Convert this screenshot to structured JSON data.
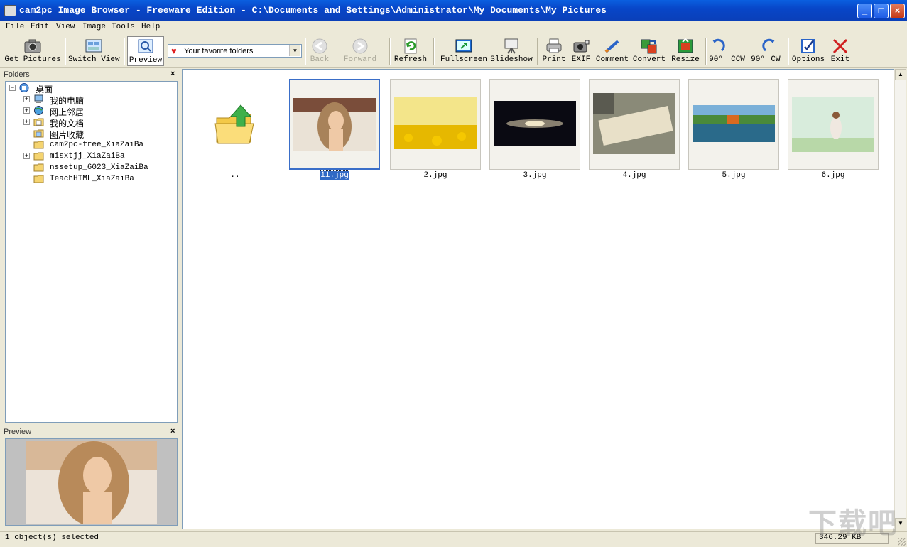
{
  "window": {
    "title": "cam2pc Image Browser - Freeware Edition - C:\\Documents and Settings\\Administrator\\My Documents\\My Pictures"
  },
  "menu": [
    "File",
    "Edit",
    "View",
    "Image",
    "Tools",
    "Help"
  ],
  "toolbar": {
    "get_pictures": "Get Pictures",
    "switch_view": "Switch View",
    "preview": "Preview",
    "favorites_placeholder": "Your favorite folders",
    "back": "Back",
    "forward": "Forward",
    "refresh": "Refresh",
    "fullscreen": "Fullscreen",
    "slideshow": "Slideshow",
    "print": "Print",
    "exif": "EXIF",
    "comment": "Comment",
    "convert": "Convert",
    "resize": "Resize",
    "rot_ccw_deg": "90°",
    "rot_ccw": "CCW",
    "rot_cw_deg": "90°",
    "rot_cw": "CW",
    "options": "Options",
    "exit": "Exit"
  },
  "folders": {
    "title": "Folders",
    "close": "×",
    "tree": [
      {
        "label": "桌面"
      },
      {
        "label": "我的电脑"
      },
      {
        "label": "网上邻居"
      },
      {
        "label": "我的文档"
      },
      {
        "label": "图片收藏"
      },
      {
        "label": "cam2pc-free_XiaZaiBa"
      },
      {
        "label": "misxtjj_XiaZaiBa"
      },
      {
        "label": "nssetup_6023_XiaZaiBa"
      },
      {
        "label": "TeachHTML_XiaZaiBa"
      }
    ]
  },
  "preview": {
    "title": "Preview",
    "close": "×"
  },
  "files": [
    {
      "name": ".."
    },
    {
      "name": "11.jpg"
    },
    {
      "name": "2.jpg"
    },
    {
      "name": "3.jpg"
    },
    {
      "name": "4.jpg"
    },
    {
      "name": "5.jpg"
    },
    {
      "name": "6.jpg"
    }
  ],
  "status": {
    "selection": "1 object(s) selected",
    "size": "346.29 KB"
  },
  "watermark": "下载吧"
}
